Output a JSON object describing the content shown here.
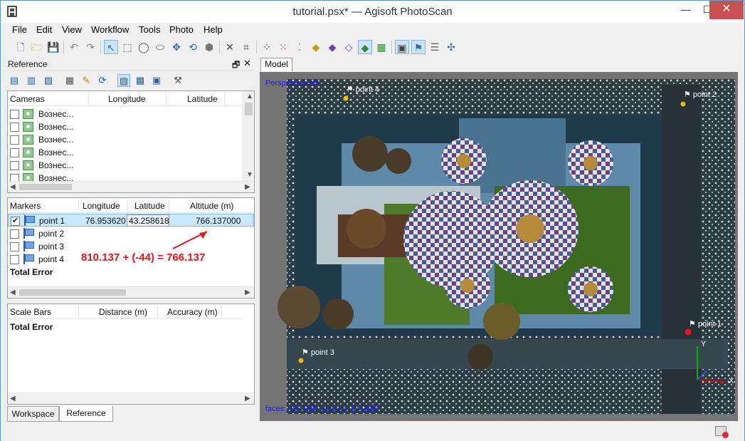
{
  "window": {
    "title": "tutorial.psx* — Agisoft PhotoScan",
    "min_label": "—",
    "max_label": "☐",
    "close_label": "✕"
  },
  "menu": [
    "File",
    "Edit",
    "View",
    "Workflow",
    "Tools",
    "Photo",
    "Help"
  ],
  "toolbar_icons": [
    "new-document-icon",
    "open-folder-icon",
    "save-icon",
    "undo-icon",
    "redo-icon",
    "select-arrow-icon",
    "rectangle-selection-icon",
    "circle-selection-icon",
    "free-form-selection-icon",
    "move-object-icon",
    "rotate-object-icon",
    "scale-object-icon",
    "delete-selection-icon",
    "crop-icon",
    "show-cameras-icon",
    "dense-cloud-icon",
    "point-cloud-icon",
    "shaded-model-icon",
    "solid-model-icon",
    "wireframe-model-icon",
    "textured-model-icon",
    "tiled-model-icon",
    "show-photos-icon",
    "show-markers-icon",
    "show-shapes-icon",
    "navigation-icon"
  ],
  "reference_panel": {
    "title": "Reference",
    "float_label": "🗗",
    "close_label": "✕",
    "cameras": {
      "headers": [
        "Cameras",
        "Longitude",
        "Latitude"
      ],
      "rows": [
        "Вознес...",
        "Вознес...",
        "Вознес...",
        "Вознес...",
        "Вознес...",
        "Вознес..."
      ]
    },
    "markers": {
      "headers": [
        "Markers",
        "Longitude",
        "Latitude",
        "Altitude (m)"
      ],
      "rows": [
        {
          "name": "point 1",
          "checked": true,
          "longitude": "76.953620",
          "latitude": "43.258618",
          "altitude": "766.137000"
        },
        {
          "name": "point 2",
          "checked": false
        },
        {
          "name": "point 3",
          "checked": false
        },
        {
          "name": "point 4",
          "checked": false
        }
      ],
      "total": "Total Error"
    },
    "scale_bars": {
      "headers": [
        "Scale Bars",
        "Distance (m)",
        "Accuracy (m)"
      ],
      "total": "Total Error"
    }
  },
  "bottom_tabs": [
    "Workspace",
    "Reference"
  ],
  "model": {
    "tab": "Model",
    "perspective": "Perspective 30°",
    "stats": "faces: 497,905 vertices: 274,886",
    "axis_x": "X",
    "axis_y": "Y",
    "markers": [
      "point 4",
      "point 2",
      "point 1",
      "point 3"
    ]
  },
  "annotation": "810.137 + (-44) = 766.137",
  "colors": {
    "accent": "#3a6ea5",
    "selection": "#cce8ff",
    "annotation": "#e8141c",
    "viewport_text": "#1a1aff"
  }
}
